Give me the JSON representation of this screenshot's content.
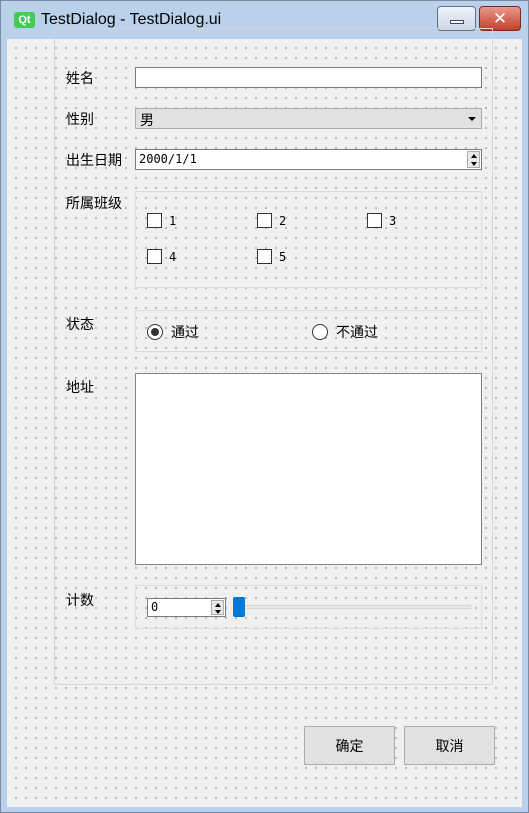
{
  "window": {
    "icon_text": "Qt",
    "title": "TestDialog - TestDialog.ui",
    "close_glyph": "✕"
  },
  "form": {
    "name_label": "姓名",
    "name_value": "",
    "gender_label": "性别",
    "gender_value": "男",
    "birthdate_label": "出生日期",
    "birthdate_value": "2000/1/1",
    "class_label": "所属班级",
    "classes": [
      "1",
      "2",
      "3",
      "4",
      "5"
    ],
    "status_label": "状态",
    "status_options": [
      "通过",
      "不通过"
    ],
    "status_selected": "通过",
    "address_label": "地址",
    "address_value": "",
    "count_label": "计数",
    "count_value": "0",
    "count_slider_value": 0
  },
  "buttons": {
    "ok": "确定",
    "cancel": "取消"
  },
  "colors": {
    "titlebar": "#b9d1ea",
    "slider_handle": "#0078d7",
    "close_button": "#c2402b"
  }
}
